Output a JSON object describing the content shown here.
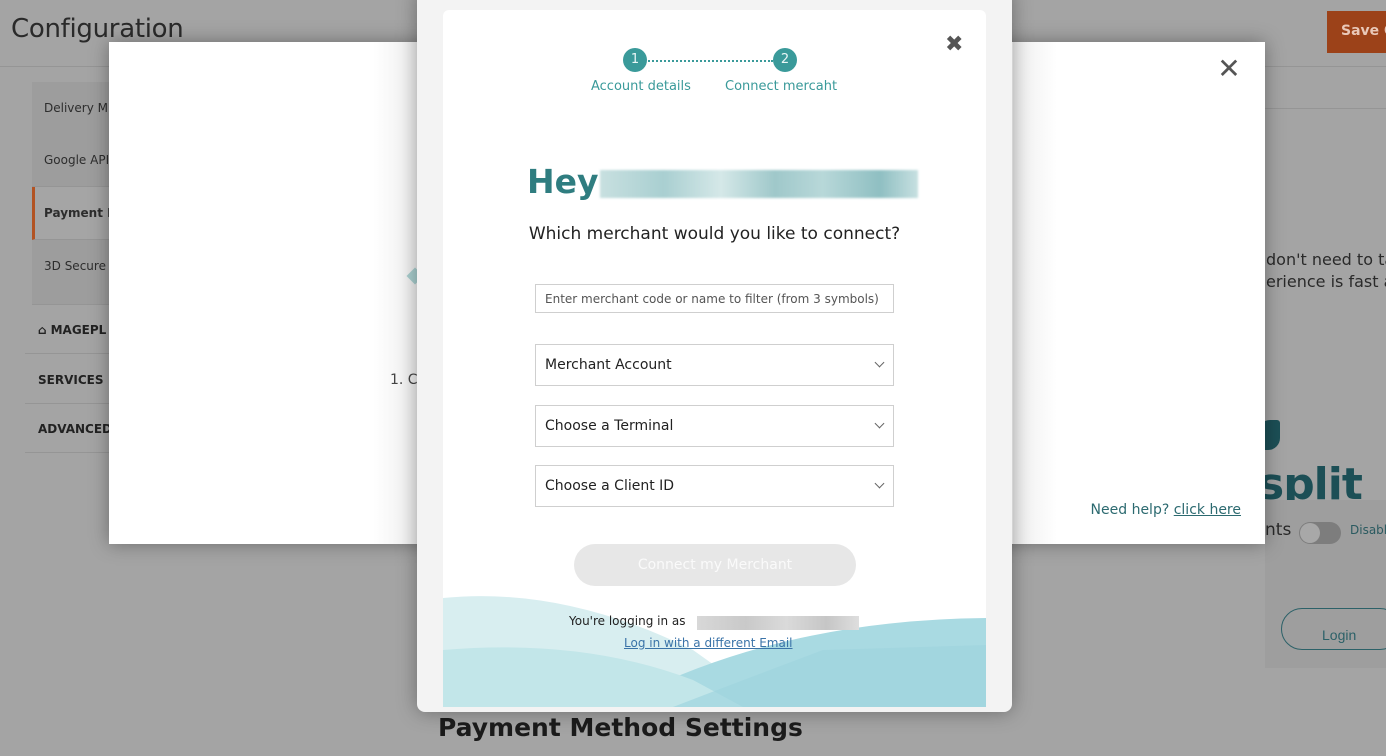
{
  "background": {
    "page_title": "Configuration",
    "save_button": "Save C",
    "sidebar": {
      "sub_items": [
        {
          "label": "Delivery M",
          "active": false
        },
        {
          "label": "Google API",
          "active": false
        },
        {
          "label": "Payment M",
          "active": true
        },
        {
          "label": "3D Secure",
          "active": false
        }
      ],
      "groups": [
        {
          "label": "MAGEPL",
          "icon": "mageplaza-logo-icon"
        },
        {
          "label": "SERVICES"
        },
        {
          "label": "ADVANCED"
        }
      ]
    },
    "right_text_lines": [
      "don't need to ta",
      "erience is fast a"
    ],
    "split_logo": "split",
    "toggle_label": "nts",
    "toggle_state": "Disabl",
    "toggle_on": false,
    "login_button": "Login",
    "section_title": "Payment Method Settings",
    "colors": {
      "save_button": "#9c4219",
      "accent": "#b25323",
      "split": "#1c4f56"
    }
  },
  "modal_back": {
    "close_icon": "close-icon",
    "step_text": "1. C",
    "help_text": "Need help?",
    "help_link": "click here"
  },
  "modal_front": {
    "close_icon": "close-icon",
    "steps": [
      {
        "number": "1",
        "label": "Account details"
      },
      {
        "number": "2",
        "label": "Connect mercaht"
      }
    ],
    "greeting": "Hey",
    "question": "Which merchant would you like to connect?",
    "filter": {
      "placeholder": "Enter merchant code or name to filter (from 3 symbols)",
      "value": ""
    },
    "selects": [
      {
        "name": "merchant-account-select",
        "selected": "Merchant Account"
      },
      {
        "name": "terminal-select",
        "selected": "Choose a Terminal"
      },
      {
        "name": "client-id-select",
        "selected": "Choose a Client ID"
      }
    ],
    "connect_button": "Connect my Merchant",
    "logging_in_as": "You're logging in as",
    "different_email_link": "Log in with a different Email",
    "colors": {
      "primary": "#3a9a9a",
      "greeting": "#2f7d80",
      "link": "#3a73a8"
    }
  }
}
